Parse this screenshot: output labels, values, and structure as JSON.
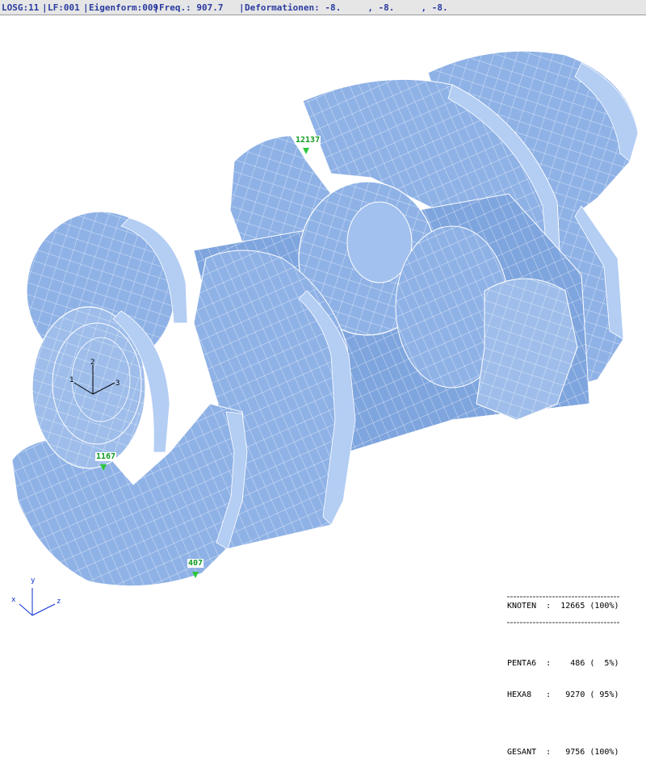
{
  "status_bar": {
    "losg": "LOSG:11",
    "lf": "LF:001",
    "eigenform": "Eigenform:009",
    "freq": "Freq.: 907.7",
    "deformationen": "Deformationen: -8.     , -8.     , -8."
  },
  "node_labels": [
    {
      "id": "12137"
    },
    {
      "id": "1167"
    },
    {
      "id": "407"
    }
  ],
  "local_axes": {
    "labels": [
      "1",
      "2",
      "3"
    ]
  },
  "global_triad": {
    "x": "x",
    "y": "y",
    "z": "z"
  },
  "stats": {
    "knoten_label": "KNOTEN",
    "knoten_value": "12665 (100%)",
    "penta6_label": "PENTA6",
    "penta6_value": "486 (  5%)",
    "hexa8_label": "HEXA8",
    "hexa8_value": "9270 ( 95%)",
    "gesamt_label": "GESANT",
    "gesamt_value": "9756 (100%)"
  },
  "colors": {
    "mesh_fill": "#8fb2e6",
    "mesh_light": "#b3cdf3",
    "mesh_dark": "#5f84c4",
    "mesh_lines": "#ffffff",
    "node_label": "#0d9a1f",
    "status_text": "#2a3ba0"
  }
}
